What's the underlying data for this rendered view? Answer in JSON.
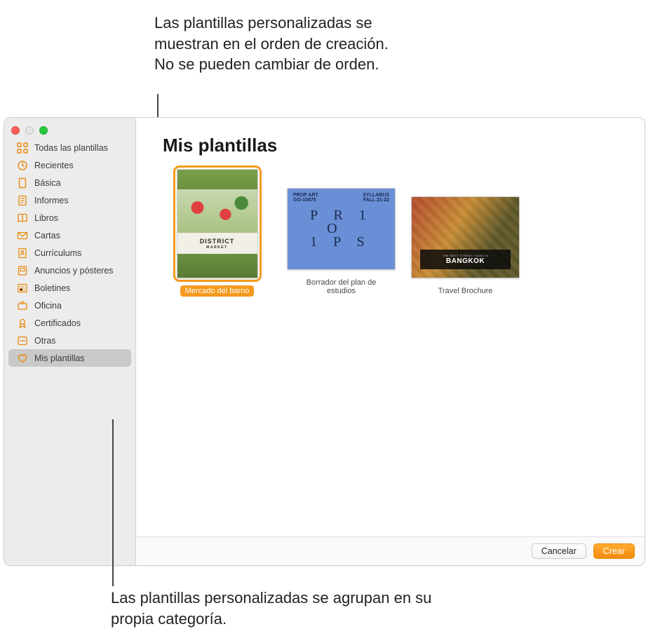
{
  "annotations": {
    "top": "Las plantillas personalizadas se muestran en el orden de creación. No se pueden cambiar de orden.",
    "bottom": "Las plantillas personalizadas se agrupan en su propia categoría."
  },
  "sidebar": {
    "items": [
      {
        "label": "Todas las plantillas",
        "icon": "grid"
      },
      {
        "label": "Recientes",
        "icon": "clock"
      },
      {
        "label": "Básica",
        "icon": "doc"
      },
      {
        "label": "Informes",
        "icon": "text-doc"
      },
      {
        "label": "Libros",
        "icon": "book"
      },
      {
        "label": "Cartas",
        "icon": "envelope"
      },
      {
        "label": "Currículums",
        "icon": "person-doc"
      },
      {
        "label": "Anuncios y pósteres",
        "icon": "poster"
      },
      {
        "label": "Boletines",
        "icon": "news"
      },
      {
        "label": "Oficina",
        "icon": "briefcase"
      },
      {
        "label": "Certificados",
        "icon": "ribbon"
      },
      {
        "label": "Otras",
        "icon": "ellipsis"
      },
      {
        "label": "Mis plantillas",
        "icon": "heart"
      }
    ],
    "selectedIndex": 12
  },
  "main": {
    "title": "Mis plantillas",
    "templates": [
      {
        "label": "Mercado del barrio",
        "selected": true,
        "kind": "district",
        "text_primary": "DISTRICT",
        "text_secondary": "MARKET"
      },
      {
        "label": "Borrador del plan de estudios",
        "selected": false,
        "kind": "props",
        "text_tl_line1": "PROP ART",
        "text_tl_line2": "GO-10875",
        "text_tr_line1": "SYLLABUS",
        "text_tr_line2": "FALL 21-22",
        "grid_row1": "P R 1",
        "grid_row2": " O",
        "grid_row3": "1 P S"
      },
      {
        "label": "Travel Brochure",
        "selected": false,
        "kind": "bangkok",
        "banner_small": "THE BEST STREET FOOD IN",
        "banner_big": "BANGKOK"
      }
    ]
  },
  "footer": {
    "cancel": "Cancelar",
    "create": "Crear"
  }
}
